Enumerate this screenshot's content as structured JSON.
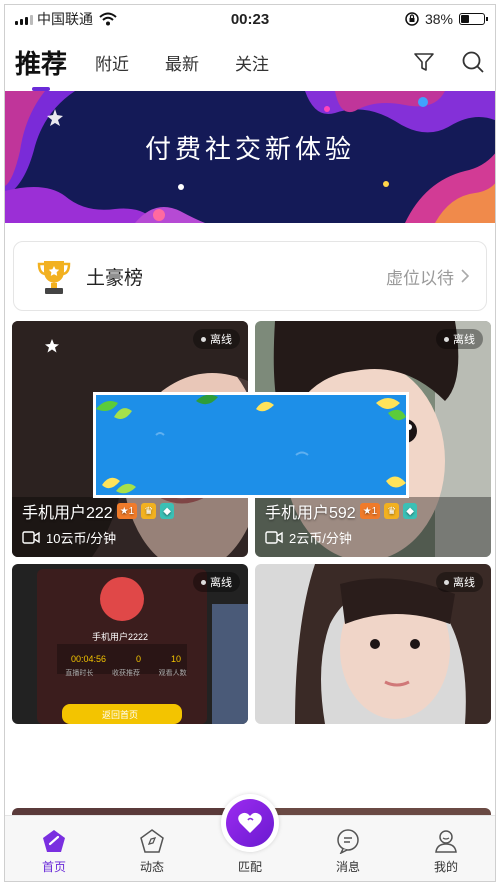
{
  "status_bar": {
    "carrier": "中国联通",
    "time": "00:23",
    "battery_text": "38%",
    "battery_level": 0.38
  },
  "tabs": [
    {
      "label": "推荐",
      "active": true
    },
    {
      "label": "附近"
    },
    {
      "label": "最新"
    },
    {
      "label": "关注"
    }
  ],
  "icons": {
    "filter": "filter-icon",
    "search": "search-icon"
  },
  "banner": {
    "title": "付费社交新体验"
  },
  "rich_list": {
    "label": "土豪榜",
    "more": "虚位以待"
  },
  "cards": [
    {
      "status": "离线",
      "name": "手机用户222",
      "levels": [
        "1",
        "1",
        "2"
      ],
      "price": "10云币/分钟"
    },
    {
      "status": "离线",
      "name": "手机用户592",
      "levels": [
        "1",
        "1",
        "2"
      ],
      "price": "2云币/分钟"
    },
    {
      "status": "离线"
    },
    {
      "status": "离线"
    }
  ],
  "card3_screen": {
    "name": "手机用户2222",
    "t1": "00:04:56",
    "t2": "0",
    "t3": "10",
    "l1": "直播时长",
    "l2": "收获推荐",
    "l3": "观看人数",
    "btn": "返回首页"
  },
  "bottom_tabs": [
    {
      "label": "首页",
      "icon": "home-icon",
      "active": true
    },
    {
      "label": "动态",
      "icon": "compass-icon"
    },
    {
      "label": "匹配",
      "icon": "match-heart-icon"
    },
    {
      "label": "消息",
      "icon": "message-icon"
    },
    {
      "label": "我的",
      "icon": "profile-icon"
    }
  ],
  "colors": {
    "accent": "#6a2bd8",
    "banner_bg": "#141a57",
    "ad_blue": "#1d8fe8"
  }
}
